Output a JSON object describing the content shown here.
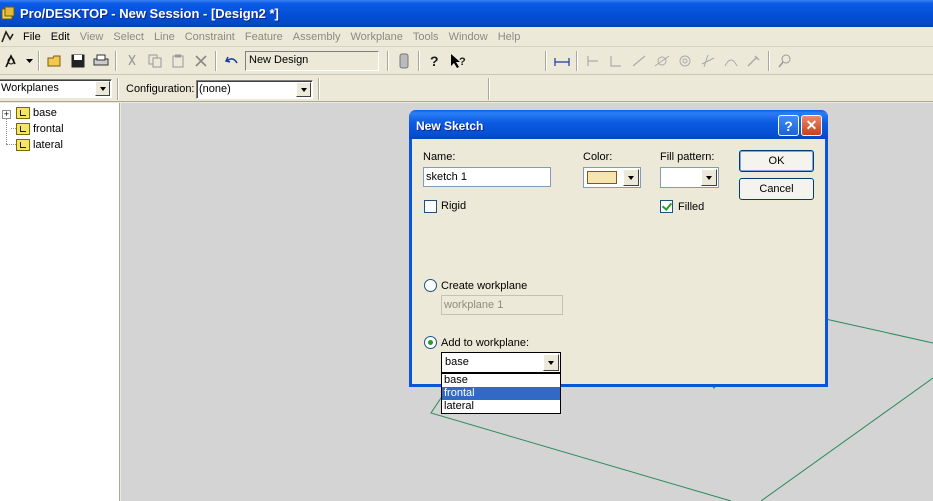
{
  "window": {
    "title": "Pro/DESKTOP - New Session - [Design2 *]"
  },
  "menu": {
    "items": [
      {
        "label": "File",
        "enabled": true
      },
      {
        "label": "Edit",
        "enabled": true
      },
      {
        "label": "View",
        "enabled": false
      },
      {
        "label": "Select",
        "enabled": false
      },
      {
        "label": "Line",
        "enabled": false
      },
      {
        "label": "Constraint",
        "enabled": false
      },
      {
        "label": "Feature",
        "enabled": false
      },
      {
        "label": "Assembly",
        "enabled": false
      },
      {
        "label": "Workplane",
        "enabled": false
      },
      {
        "label": "Tools",
        "enabled": false
      },
      {
        "label": "Window",
        "enabled": false
      },
      {
        "label": "Help",
        "enabled": false
      }
    ]
  },
  "toolbar": {
    "design_field": "New Design"
  },
  "bar2": {
    "tree_mode": "Workplanes",
    "config_label": "Configuration:",
    "config_value": "(none)"
  },
  "tree": {
    "items": [
      "base",
      "frontal",
      "lateral"
    ]
  },
  "dialog": {
    "title": "New Sketch",
    "name_label": "Name:",
    "name_value": "sketch 1",
    "color_label": "Color:",
    "fill_label": "Fill pattern:",
    "ok_label": "OK",
    "cancel_label": "Cancel",
    "rigid_label": "Rigid",
    "rigid_checked": false,
    "filled_label": "Filled",
    "filled_checked": true,
    "create_wp_label": "Create workplane",
    "create_wp_value": "workplane 1",
    "add_wp_label": "Add to workplane:",
    "add_wp_value": "base",
    "add_wp_options": [
      "base",
      "frontal",
      "lateral"
    ],
    "add_wp_highlighted": "frontal",
    "help_glyph": "?",
    "close_glyph": "✕"
  },
  "colors": {
    "titlebar": "#0550d8",
    "selection": "#316ac5",
    "viewport_bg": "#d4d4d4",
    "workplane_line": "#2b8a5a"
  }
}
